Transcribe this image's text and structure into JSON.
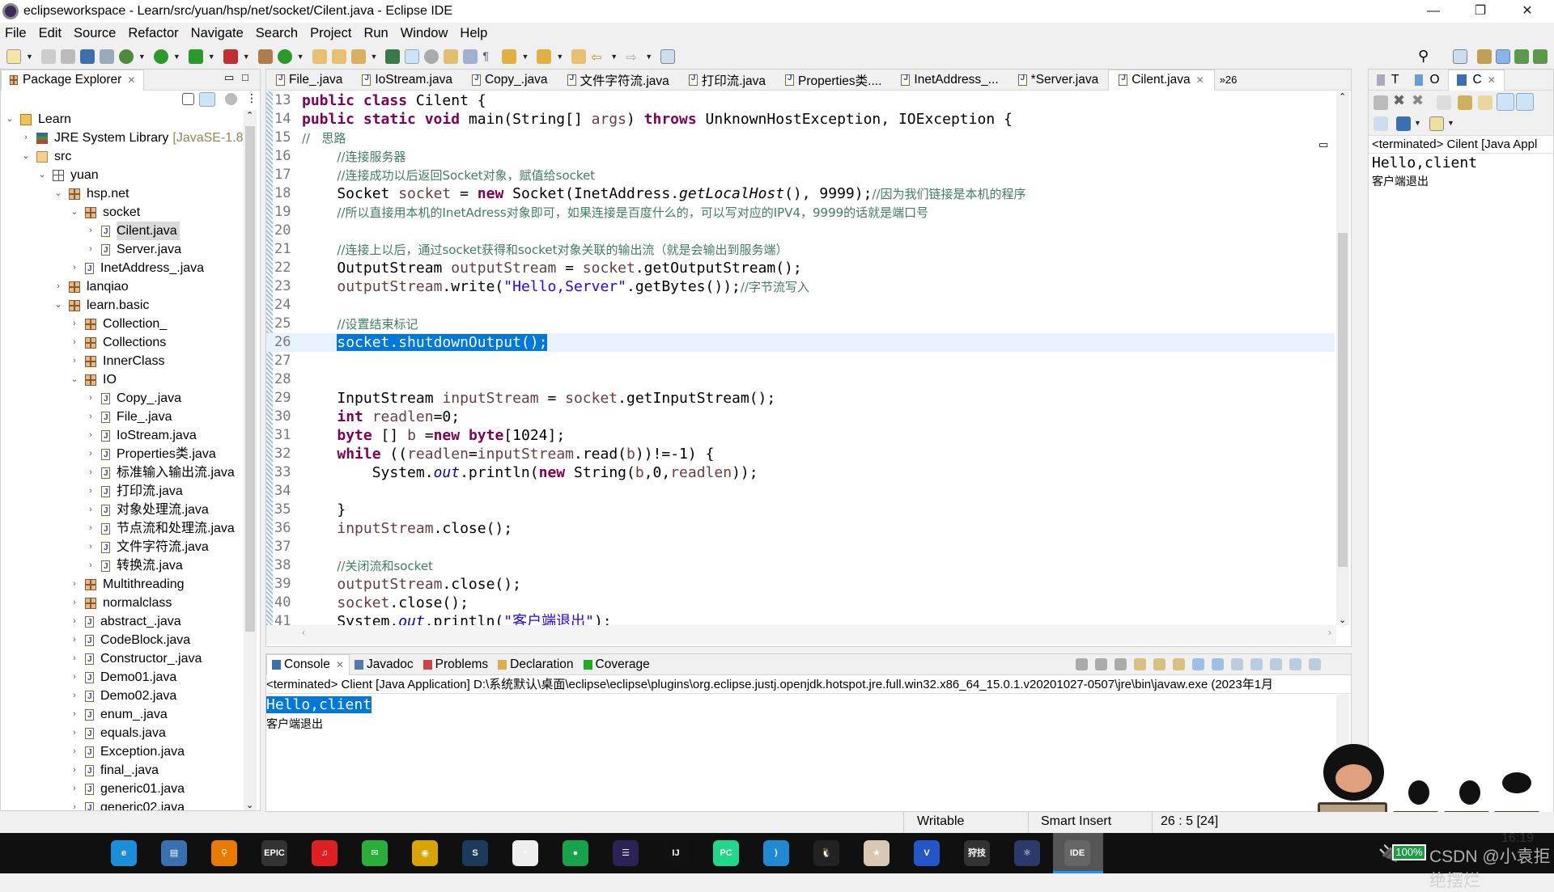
{
  "window": {
    "title": "eclipseworkspace - Learn/src/yuan/hsp/net/socket/Cilent.java - Eclipse IDE",
    "minimize": "—",
    "restore": "❐",
    "close": "✕"
  },
  "menu": [
    "File",
    "Edit",
    "Source",
    "Refactor",
    "Navigate",
    "Search",
    "Project",
    "Run",
    "Window",
    "Help"
  ],
  "package_explorer": {
    "title": "Package Explorer",
    "items": [
      {
        "label": "Learn",
        "level": 0,
        "state": "open",
        "icon": "project-icon"
      },
      {
        "label": "JRE System Library",
        "suffix": "[JavaSE-1.8]",
        "level": 1,
        "state": "closed",
        "icon": "library-icon"
      },
      {
        "label": "src",
        "level": 1,
        "state": "open",
        "icon": "source-folder-icon"
      },
      {
        "label": "yuan",
        "level": 2,
        "state": "open",
        "icon": "empty-package-icon"
      },
      {
        "label": "hsp.net",
        "level": 3,
        "state": "open",
        "icon": "package-icon"
      },
      {
        "label": "socket",
        "level": 4,
        "state": "open",
        "icon": "package-icon"
      },
      {
        "label": "Cilent.java",
        "level": 5,
        "state": "closed",
        "icon": "java-file-icon",
        "selected": true
      },
      {
        "label": "Server.java",
        "level": 5,
        "state": "closed",
        "icon": "java-file-icon"
      },
      {
        "label": "InetAddress_.java",
        "level": 4,
        "state": "closed",
        "icon": "java-file-icon"
      },
      {
        "label": "lanqiao",
        "level": 3,
        "state": "closed",
        "icon": "package-icon"
      },
      {
        "label": "learn.basic",
        "level": 3,
        "state": "open",
        "icon": "package-icon"
      },
      {
        "label": "Collection_",
        "level": 4,
        "state": "closed",
        "icon": "package-icon"
      },
      {
        "label": "Collections",
        "level": 4,
        "state": "closed",
        "icon": "package-icon"
      },
      {
        "label": "InnerClass",
        "level": 4,
        "state": "closed",
        "icon": "package-icon"
      },
      {
        "label": "IO",
        "level": 4,
        "state": "open",
        "icon": "package-icon"
      },
      {
        "label": "Copy_.java",
        "level": 5,
        "state": "closed",
        "icon": "java-file-icon"
      },
      {
        "label": "File_.java",
        "level": 5,
        "state": "closed",
        "icon": "java-file-icon"
      },
      {
        "label": "IoStream.java",
        "level": 5,
        "state": "closed",
        "icon": "java-file-icon"
      },
      {
        "label": "Properties类.java",
        "level": 5,
        "state": "closed",
        "icon": "java-file-icon"
      },
      {
        "label": "标准输入输出流.java",
        "level": 5,
        "state": "closed",
        "icon": "java-file-icon"
      },
      {
        "label": "打印流.java",
        "level": 5,
        "state": "closed",
        "icon": "java-file-icon"
      },
      {
        "label": "对象处理流.java",
        "level": 5,
        "state": "closed",
        "icon": "java-file-icon"
      },
      {
        "label": "节点流和处理流.java",
        "level": 5,
        "state": "closed",
        "icon": "java-file-icon"
      },
      {
        "label": "文件字符流.java",
        "level": 5,
        "state": "closed",
        "icon": "java-file-icon"
      },
      {
        "label": "转换流.java",
        "level": 5,
        "state": "closed",
        "icon": "java-file-icon"
      },
      {
        "label": "Multithreading",
        "level": 4,
        "state": "closed",
        "icon": "package-icon"
      },
      {
        "label": "normalclass",
        "level": 4,
        "state": "closed",
        "icon": "package-icon"
      },
      {
        "label": "abstract_.java",
        "level": 4,
        "state": "closed",
        "icon": "java-file-icon"
      },
      {
        "label": "CodeBlock.java",
        "level": 4,
        "state": "closed",
        "icon": "java-file-icon"
      },
      {
        "label": "Constructor_.java",
        "level": 4,
        "state": "closed",
        "icon": "java-file-icon"
      },
      {
        "label": "Demo01.java",
        "level": 4,
        "state": "closed",
        "icon": "java-file-icon"
      },
      {
        "label": "Demo02.java",
        "level": 4,
        "state": "closed",
        "icon": "java-file-icon"
      },
      {
        "label": "enum_.java",
        "level": 4,
        "state": "closed",
        "icon": "java-file-icon"
      },
      {
        "label": "equals.java",
        "level": 4,
        "state": "closed",
        "icon": "java-file-icon"
      },
      {
        "label": "Exception.java",
        "level": 4,
        "state": "closed",
        "icon": "java-file-icon"
      },
      {
        "label": "final_.java",
        "level": 4,
        "state": "closed",
        "icon": "java-file-icon"
      },
      {
        "label": "generic01.java",
        "level": 4,
        "state": "closed",
        "icon": "java-file-icon"
      },
      {
        "label": "generic02.java",
        "level": 4,
        "state": "closed",
        "icon": "java-file-icon"
      }
    ]
  },
  "editor": {
    "tabs": [
      {
        "label": "File_.java"
      },
      {
        "label": "IoStream.java"
      },
      {
        "label": "Copy_.java"
      },
      {
        "label": "文件字符流.java"
      },
      {
        "label": "打印流.java"
      },
      {
        "label": "Properties类...."
      },
      {
        "label": "InetAddress_..."
      },
      {
        "label": "*Server.java"
      },
      {
        "label": "Cilent.java",
        "active": true
      }
    ],
    "overflow": "»26",
    "current_line": 26,
    "lines": [
      {
        "n": "13",
        "t": [
          [
            "public class ",
            "kw"
          ],
          [
            "Cilent {",
            ""
          ]
        ]
      },
      {
        "n": "14",
        "t": [
          [
            "public static void ",
            "kw"
          ],
          [
            "main(String[] ",
            ""
          ],
          [
            "args",
            "var"
          ],
          [
            ") ",
            ""
          ],
          [
            "throws ",
            "kw"
          ],
          [
            "UnknownHostException, IOException {",
            ""
          ]
        ]
      },
      {
        "n": "15",
        "t": [
          [
            "//   思路",
            "cm"
          ]
        ]
      },
      {
        "n": "16",
        "t": [
          [
            "    ",
            ""
          ],
          [
            "//连接服务器",
            "cm"
          ]
        ]
      },
      {
        "n": "17",
        "t": [
          [
            "    ",
            ""
          ],
          [
            "//连接成功以后返回Socket对象，赋值给socket",
            "cm"
          ]
        ]
      },
      {
        "n": "18",
        "t": [
          [
            "    Socket ",
            ""
          ],
          [
            "socket",
            "var"
          ],
          [
            " = ",
            ""
          ],
          [
            "new ",
            "kw"
          ],
          [
            "Socket(InetAddress.",
            ""
          ],
          [
            "getLocalHost",
            "it"
          ],
          [
            "(), 9999);",
            ""
          ],
          [
            "//因为我们链接是本机的程序",
            "cm"
          ]
        ]
      },
      {
        "n": "19",
        "t": [
          [
            "    ",
            ""
          ],
          [
            "//所以直接用本机的InetAdress对象即可，如果连接是百度什么的，可以写对应的IPV4，9999的话就是端口号",
            "cm"
          ]
        ]
      },
      {
        "n": "20",
        "t": []
      },
      {
        "n": "21",
        "t": [
          [
            "    ",
            ""
          ],
          [
            "//连接上以后，通过socket获得和socket对象关联的输出流（就是会输出到服务端）",
            "cm"
          ]
        ]
      },
      {
        "n": "22",
        "t": [
          [
            "    OutputStream ",
            ""
          ],
          [
            "outputStream",
            "var"
          ],
          [
            " = ",
            ""
          ],
          [
            "socket",
            "var"
          ],
          [
            ".getOutputStream();",
            ""
          ]
        ]
      },
      {
        "n": "23",
        "t": [
          [
            "    ",
            ""
          ],
          [
            "outputStream",
            "var"
          ],
          [
            ".write(",
            ""
          ],
          [
            "\"Hello,Server\"",
            "str"
          ],
          [
            ".getBytes());",
            ""
          ],
          [
            "//字节流写入",
            "cm"
          ]
        ]
      },
      {
        "n": "24",
        "t": []
      },
      {
        "n": "25",
        "t": [
          [
            "    ",
            ""
          ],
          [
            "//设置结束标记",
            "cm"
          ]
        ]
      },
      {
        "n": "26",
        "t": [
          [
            "    ",
            ""
          ],
          [
            "socket.shutdownOutput();",
            "sel"
          ]
        ]
      },
      {
        "n": "27",
        "t": []
      },
      {
        "n": "28",
        "t": []
      },
      {
        "n": "29",
        "t": [
          [
            "    InputStream ",
            ""
          ],
          [
            "inputStream",
            "var"
          ],
          [
            " = ",
            ""
          ],
          [
            "socket",
            "var"
          ],
          [
            ".getInputStream();",
            ""
          ]
        ]
      },
      {
        "n": "30",
        "t": [
          [
            "    ",
            ""
          ],
          [
            "int ",
            "kw"
          ],
          [
            "readlen",
            "var"
          ],
          [
            "=0;",
            ""
          ]
        ]
      },
      {
        "n": "31",
        "t": [
          [
            "    ",
            ""
          ],
          [
            "byte ",
            "kw"
          ],
          [
            "[] ",
            ""
          ],
          [
            "b",
            "var"
          ],
          [
            " =",
            ""
          ],
          [
            "new ",
            "kw"
          ],
          [
            "byte",
            "kw"
          ],
          [
            "[1024];",
            ""
          ]
        ]
      },
      {
        "n": "32",
        "t": [
          [
            "    ",
            ""
          ],
          [
            "while ",
            "kw"
          ],
          [
            "((",
            ""
          ],
          [
            "readlen",
            "var"
          ],
          [
            "=",
            ""
          ],
          [
            "inputStream",
            "var"
          ],
          [
            ".read(",
            ""
          ],
          [
            "b",
            "var"
          ],
          [
            "))!=-1) {",
            ""
          ]
        ]
      },
      {
        "n": "33",
        "t": [
          [
            "        System.",
            ""
          ],
          [
            "out",
            "fld"
          ],
          [
            ".println(",
            ""
          ],
          [
            "new ",
            "kw"
          ],
          [
            "String(",
            ""
          ],
          [
            "b",
            "var"
          ],
          [
            ",0,",
            ""
          ],
          [
            "readlen",
            "var"
          ],
          [
            "));",
            ""
          ]
        ]
      },
      {
        "n": "34",
        "t": []
      },
      {
        "n": "35",
        "t": [
          [
            "    }",
            ""
          ]
        ]
      },
      {
        "n": "36",
        "t": [
          [
            "    ",
            ""
          ],
          [
            "inputStream",
            "var"
          ],
          [
            ".close();",
            ""
          ]
        ]
      },
      {
        "n": "37",
        "t": []
      },
      {
        "n": "38",
        "t": [
          [
            "    ",
            ""
          ],
          [
            "//关闭流和socket",
            "cm"
          ]
        ]
      },
      {
        "n": "39",
        "t": [
          [
            "    ",
            ""
          ],
          [
            "outputStream",
            "var"
          ],
          [
            ".close();",
            ""
          ]
        ]
      },
      {
        "n": "40",
        "t": [
          [
            "    ",
            ""
          ],
          [
            "socket",
            "var"
          ],
          [
            ".close();",
            ""
          ]
        ]
      },
      {
        "n": "41",
        "t": [
          [
            "    System.",
            ""
          ],
          [
            "out",
            "fld"
          ],
          [
            ".println(",
            ""
          ],
          [
            "\"客户端退出\"",
            "str"
          ],
          [
            ");",
            ""
          ]
        ]
      }
    ]
  },
  "console": {
    "tabs": [
      "Console",
      "Javadoc",
      "Problems",
      "Declaration",
      "Coverage"
    ],
    "header": "<terminated> Client [Java Application] D:\\系统默认\\桌面\\eclipse\\eclipse\\plugins\\org.eclipse.justj.openjdk.hotspot.jre.full.win32.x86_64_15.0.1.v20201027-0507\\jre\\bin\\javaw.exe  (2023年1月",
    "output": [
      "Hello,client",
      "客户端退出"
    ]
  },
  "right_panel": {
    "tabs": [
      "T",
      "O",
      "C"
    ],
    "header": "<terminated> Cilent [Java Appl",
    "output": [
      "Hello,client",
      "客户端退出"
    ]
  },
  "status": {
    "writable": "Writable",
    "insert_mode": "Smart Insert",
    "position": "26 : 5 [24]"
  },
  "mascot": {
    "boxes": [
      "英",
      "•,",
      "👕"
    ]
  },
  "taskbar": {
    "apps": [
      {
        "name": "edge",
        "label": "e",
        "color": "#1a8fd8"
      },
      {
        "name": "files",
        "label": "▤",
        "color": "#3a6fb0"
      },
      {
        "name": "search",
        "label": "⚲",
        "color": "#e87a00"
      },
      {
        "name": "epic-games",
        "label": "EPIC",
        "color": "#333"
      },
      {
        "name": "netease-music",
        "label": "♫",
        "color": "#e02020"
      },
      {
        "name": "wechat",
        "label": "✉",
        "color": "#2aae3a"
      },
      {
        "name": "chrome",
        "label": "◉",
        "color": "#d9a400"
      },
      {
        "name": "steam",
        "label": "S",
        "color": "#1b3a5c"
      },
      {
        "name": "app-thunder",
        "label": "⚡",
        "color": "#eee"
      },
      {
        "name": "app-green",
        "label": "●",
        "color": "#17a34a"
      },
      {
        "name": "eclipse",
        "label": "☰",
        "color": "#2c2255"
      },
      {
        "name": "intellij",
        "label": "IJ",
        "color": "#111"
      },
      {
        "name": "pycharm",
        "label": "PC",
        "color": "#21d789"
      },
      {
        "name": "vscode",
        "label": "⟩",
        "color": "#1f8ad2"
      },
      {
        "name": "qq",
        "label": "🐧",
        "color": "#222"
      },
      {
        "name": "game-app",
        "label": "★",
        "color": "#d9c8b4"
      },
      {
        "name": "app-v4",
        "label": "V",
        "color": "#2556c9"
      },
      {
        "name": "modbox",
        "label": "狩技",
        "color": "#333"
      },
      {
        "name": "atom-app",
        "label": "⚛",
        "color": "#2b3a6a"
      },
      {
        "name": "java-ee-ide",
        "label": "IDE",
        "color": "#666",
        "active": true
      }
    ],
    "battery": "100%",
    "clock": "16:19",
    "watermark": "CSDN @小袁拒绝摆烂"
  }
}
